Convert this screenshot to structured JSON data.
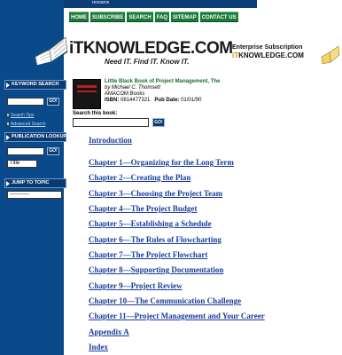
{
  "topbar": {
    "mini_text": "resource"
  },
  "nav": [
    "HOME",
    "SUBSCRIBE",
    "SEARCH",
    "FAQ",
    "SITEMAP",
    "CONTACT US"
  ],
  "logo": {
    "it": "iT",
    "brand": "KNOWLEDGE.COM",
    "tagline": "Need IT. Find IT. Know IT."
  },
  "enterprise": {
    "line1": "Enterprise Subscription",
    "line2_it": "iT",
    "line2_rest": "KNOWLEDGE.COM"
  },
  "sidebar": {
    "keyword_search": {
      "header": "KEYWORD SEARCH",
      "go": "GO!",
      "search_tips": "Search Tips",
      "advanced_search": "Advanced Search"
    },
    "publication_lookup": {
      "header": "PUBLICATION LOOKUP",
      "go": "GO!",
      "select_value": "Title"
    },
    "jump_to_topic": {
      "header": "JUMP TO TOPIC",
      "select_value": "-----------"
    }
  },
  "book": {
    "title": "Little Black Book of Project Management, The",
    "author": "by Michael C. Thomsett",
    "publisher": "AMACOM Books",
    "isbn_label": "ISBN:",
    "isbn": "0814477321",
    "pubdate_label": "Pub Date:",
    "pubdate": "01/01/90"
  },
  "book_search": {
    "label": "Search this book:",
    "go": "GO!"
  },
  "toc": [
    "Introduction",
    "Chapter 1—Organizing for the Long Term",
    "Chapter 2—Creating the Plan",
    "Chapter 3—Choosing the Project Team",
    "Chapter 4—The Project Budget",
    "Chapter 5—Establishing a Schedule",
    "Chapter 6—The Rules of Flowcharting",
    "Chapter 7—The Project Flowchart",
    "Chapter 8—Supporting Documentation",
    "Chapter 9—Project Review",
    "Chapter 10—The Communication Challenge",
    "Chapter 11—Project Management and Your Career",
    "Appendix A",
    "Index"
  ]
}
